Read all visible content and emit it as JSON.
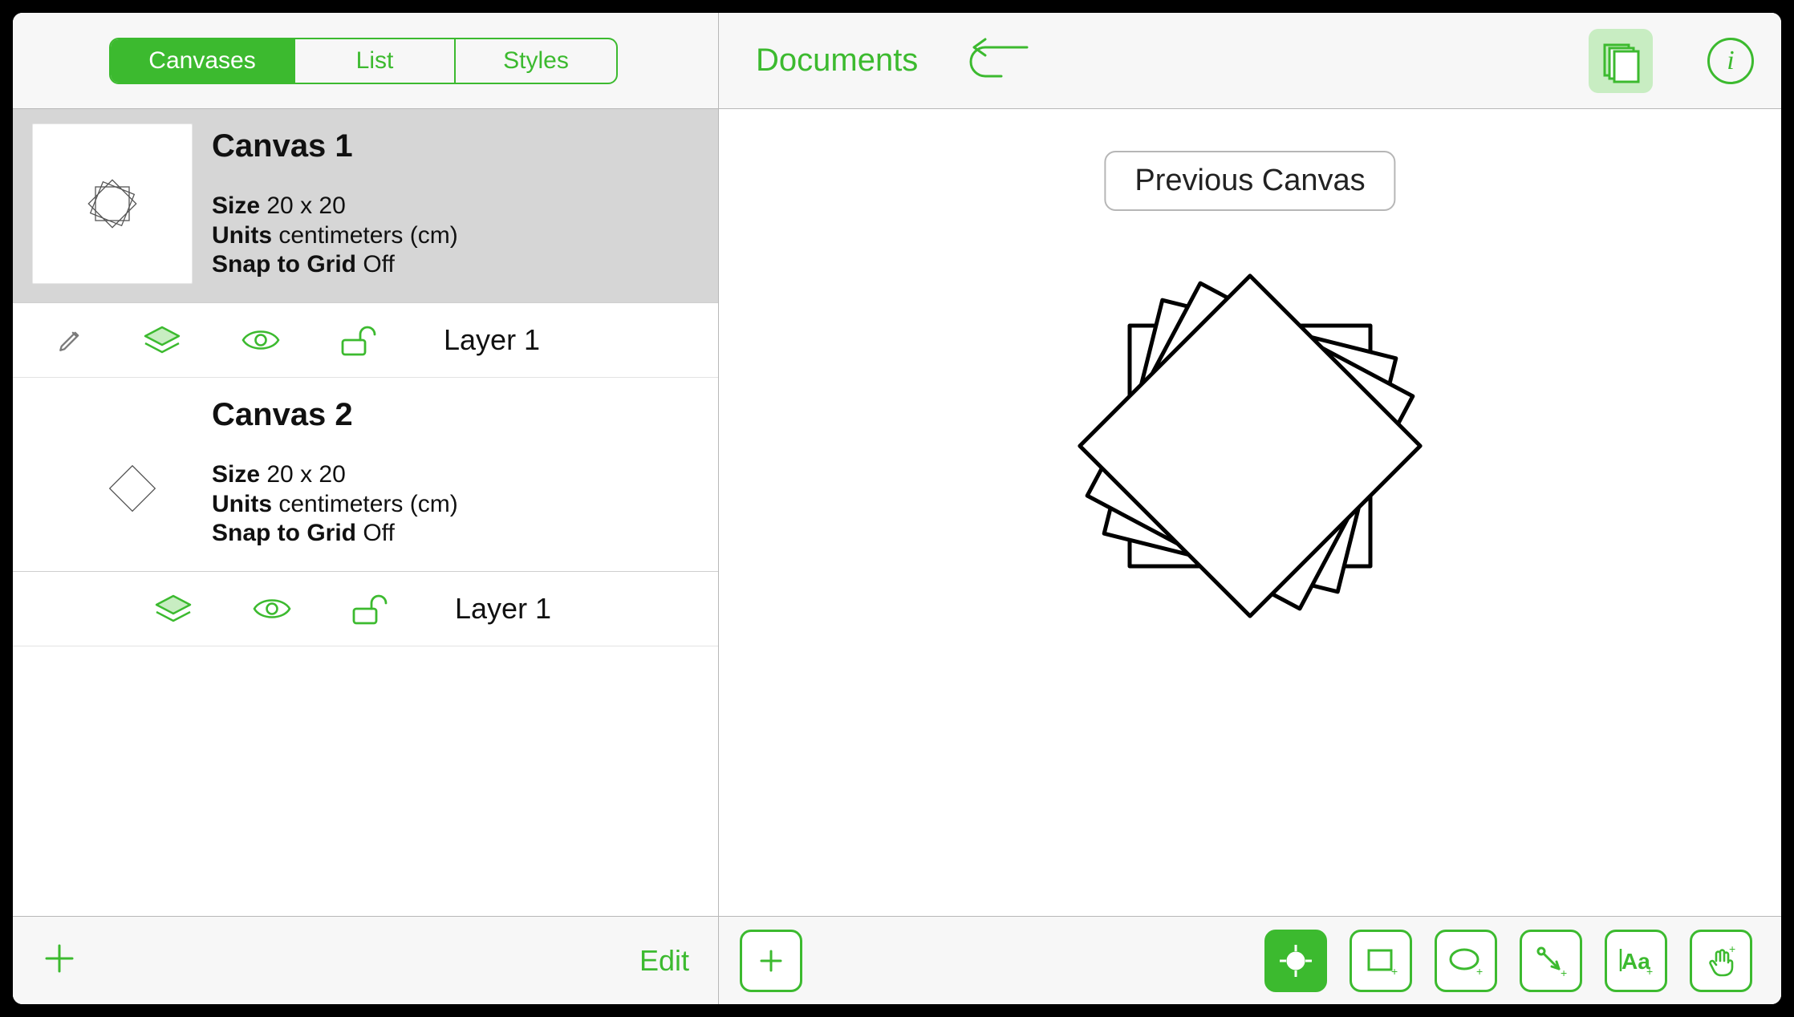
{
  "sidebar": {
    "tabs": {
      "canvases": "Canvases",
      "list": "List",
      "styles": "Styles",
      "active": "Canvases"
    },
    "canvases": [
      {
        "title": "Canvas 1",
        "selected": true,
        "size_label": "Size",
        "size_value": "20 x 20",
        "units_label": "Units",
        "units_value": "centimeters (cm)",
        "snap_label": "Snap to Grid",
        "snap_value": "Off",
        "layers": [
          {
            "name": "Layer 1",
            "editing": true
          }
        ]
      },
      {
        "title": "Canvas 2",
        "selected": false,
        "size_label": "Size",
        "size_value": "20 x 20",
        "units_label": "Units",
        "units_value": "centimeters (cm)",
        "snap_label": "Snap to Grid",
        "snap_value": "Off",
        "layers": [
          {
            "name": "Layer 1",
            "editing": false
          }
        ]
      }
    ],
    "edit_label": "Edit"
  },
  "header": {
    "documents_label": "Documents"
  },
  "canvas": {
    "tooltip": "Previous Canvas"
  },
  "toolbar": {
    "tools": [
      "add",
      "selection",
      "rect",
      "ellipse",
      "line",
      "text",
      "freehand"
    ],
    "active": "selection"
  },
  "colors": {
    "accent": "#3cba2f"
  }
}
